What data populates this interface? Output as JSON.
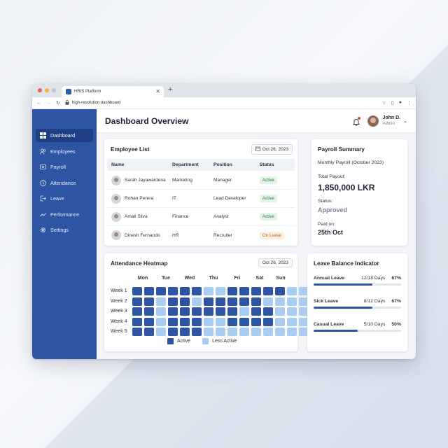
{
  "browser": {
    "tab_title": "HRIS Platform",
    "address": "high-resolution dashboard"
  },
  "sidebar": {
    "items": [
      {
        "label": "Dashboard",
        "icon": "grid-icon"
      },
      {
        "label": "Employees",
        "icon": "users-icon"
      },
      {
        "label": "Payroll",
        "icon": "payroll-icon"
      },
      {
        "label": "Attendance",
        "icon": "clock-icon"
      },
      {
        "label": "Leave",
        "icon": "exit-icon"
      },
      {
        "label": "Performance",
        "icon": "trend-icon"
      },
      {
        "label": "Settings",
        "icon": "gear-icon"
      }
    ]
  },
  "header": {
    "title": "Dashboard Overview",
    "user_name": "John D.",
    "user_role": "Admin"
  },
  "employees": {
    "title": "Employee List",
    "date": "Oct 26, 2023",
    "columns": [
      "Name",
      "Department",
      "Position",
      "Status"
    ],
    "rows": [
      {
        "name": "Sarah Jayawardena",
        "dept": "Marketing",
        "position": "Manager",
        "status": "Active"
      },
      {
        "name": "Rohan Perera",
        "dept": "IT",
        "position": "Lead Developer",
        "status": "Active"
      },
      {
        "name": "Amali Silva",
        "dept": "Finance",
        "position": "Analyst",
        "status": "Active"
      },
      {
        "name": "Dinesh Fernando",
        "dept": "HR",
        "position": "Recruiter",
        "status": "On Leave"
      }
    ]
  },
  "payroll": {
    "title": "Payroll Summary",
    "period": "Monthly Payroll (October 2023)",
    "total_label": "Total Payout:",
    "total_value": "1,850,000 LKR",
    "status_label": "Status:",
    "status_value": "Approved",
    "paid_label": "Paid on:",
    "paid_value": "25th Oct"
  },
  "attendance": {
    "title": "Attendance Heatmap",
    "date": "Oct 26, 2023",
    "days": [
      "Mon",
      "Tue",
      "Wed",
      "Thu",
      "Fri",
      "Sat",
      "Sun"
    ],
    "weeks": [
      "Week 1",
      "Week 2",
      "Week 3",
      "Week 4",
      "Week 5"
    ],
    "grid": [
      [
        1,
        1,
        1,
        1,
        1,
        1,
        0,
        0,
        1,
        1,
        1,
        1,
        1,
        0,
        0,
        1,
        1
      ],
      [
        1,
        1,
        0,
        1,
        1,
        0,
        1,
        1,
        1,
        1,
        1,
        0,
        0,
        0,
        0,
        1,
        1
      ],
      [
        1,
        1,
        0,
        1,
        1,
        1,
        1,
        1,
        1,
        0,
        1,
        1,
        0,
        0,
        0,
        1,
        1
      ],
      [
        1,
        1,
        0,
        1,
        1,
        1,
        0,
        0,
        1,
        1,
        1,
        1,
        0,
        0,
        0,
        1,
        1
      ],
      [
        1,
        1,
        0,
        1,
        1,
        1,
        0,
        0,
        0,
        0,
        0,
        0,
        0,
        0,
        0,
        1,
        1
      ]
    ],
    "legend_active": "Active",
    "legend_less": "Less Active",
    "color_active": "#2e55a3",
    "color_less": "#a9cdf0"
  },
  "leave": {
    "title": "Leave Balance Indicator",
    "items": [
      {
        "name": "Annual Leave",
        "days": "12/18 Days",
        "pct": "67%",
        "value": 0.67
      },
      {
        "name": "Sick Leave",
        "days": "8/12 Days",
        "pct": "67%",
        "value": 0.67
      },
      {
        "name": "Casual Leave",
        "days": "5/10 Days",
        "pct": "50%",
        "value": 0.5
      }
    ]
  }
}
